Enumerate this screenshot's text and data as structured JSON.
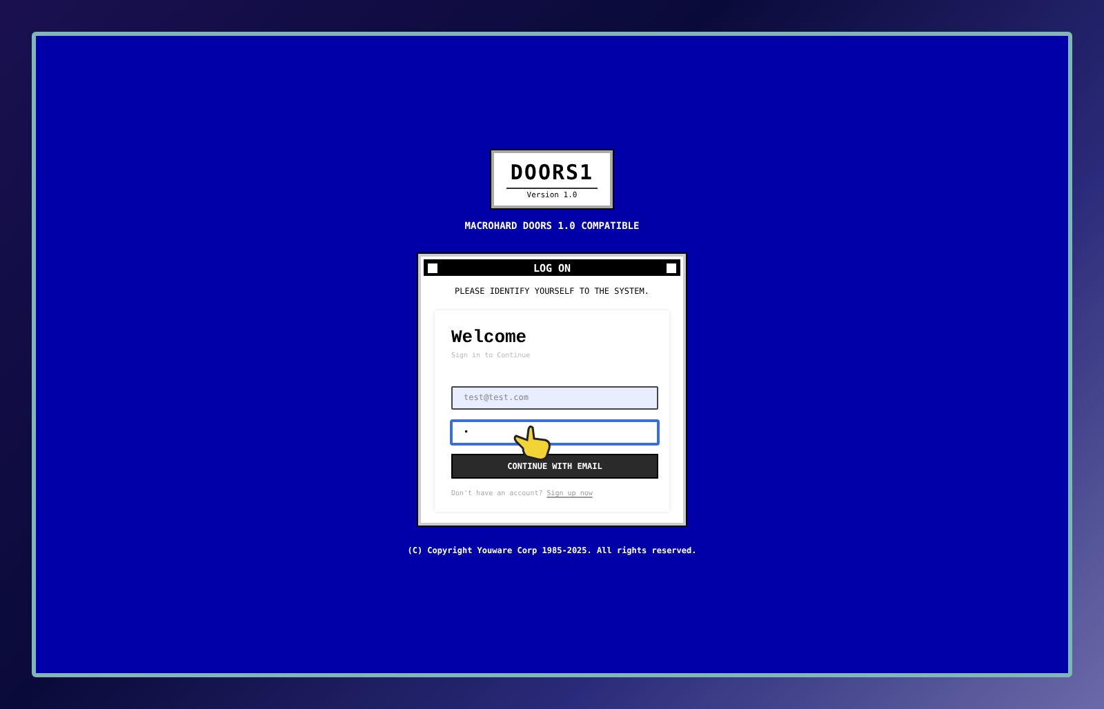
{
  "logo": {
    "title": "DOORS1",
    "version": "Version 1.0"
  },
  "subtitle": "MACROHARD DOORS 1.0 COMPATIBLE",
  "dialog": {
    "title": "LOG ON",
    "prompt": "PLEASE IDENTIFY YOURSELF TO THE SYSTEM.",
    "heading": "Welcome",
    "subheading": "Sign in to Continue",
    "email_field": {
      "placeholder": "test@test.com"
    },
    "password_field": {
      "value": "•",
      "focused": true
    },
    "button": "CONTINUE WITH EMAIL",
    "signup_text": "Don't have an account?",
    "signup_link": "Sign up now"
  },
  "copyright": "(C) Copyright Youware Corp 1985-2025. All rights reserved."
}
